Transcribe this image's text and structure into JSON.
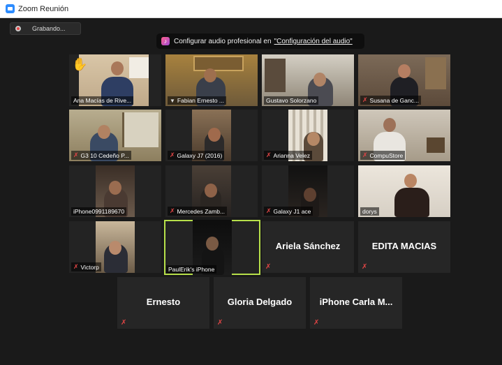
{
  "window": {
    "title": "Zoom Reunión"
  },
  "recording": {
    "label": "Grabando..."
  },
  "banner": {
    "message": "Configurar audio profesional en",
    "link": "\"Configuración del audio\""
  },
  "participants": [
    {
      "name": "Ana Macías de Rive...",
      "muted": false,
      "hand_raised": true
    },
    {
      "name": "Fabian Ernesto ...",
      "muted": false,
      "pinned": true
    },
    {
      "name": "Gustavo Solorzano",
      "muted": false
    },
    {
      "name": "Susana de Ganc...",
      "muted": true
    },
    {
      "name": "G3 10 Cedeño P...",
      "muted": true
    },
    {
      "name": "Galaxy J7 (2016)",
      "muted": true
    },
    {
      "name": "Arianna Velez",
      "muted": true
    },
    {
      "name": "CompuStore",
      "muted": true
    },
    {
      "name": "iPhone0991189670",
      "muted": false
    },
    {
      "name": "Mercedes Zamb...",
      "muted": true
    },
    {
      "name": "Galaxy J1 ace",
      "muted": true
    },
    {
      "name": "dorys",
      "muted": false
    },
    {
      "name": "Victorp",
      "muted": true
    },
    {
      "name": "PaulErik's iPhone",
      "muted": false,
      "active_speaker": true
    },
    {
      "name": "Ariela Sánchez",
      "muted": true,
      "video_off": true
    },
    {
      "name": "EDITA MACIAS",
      "muted": true,
      "video_off": true
    },
    {
      "name": "Ernesto",
      "muted": true,
      "video_off": true
    },
    {
      "name": "Gloria Delgado",
      "muted": true,
      "video_off": true
    },
    {
      "name": "iPhone Carla M...",
      "muted": true,
      "video_off": true
    }
  ]
}
